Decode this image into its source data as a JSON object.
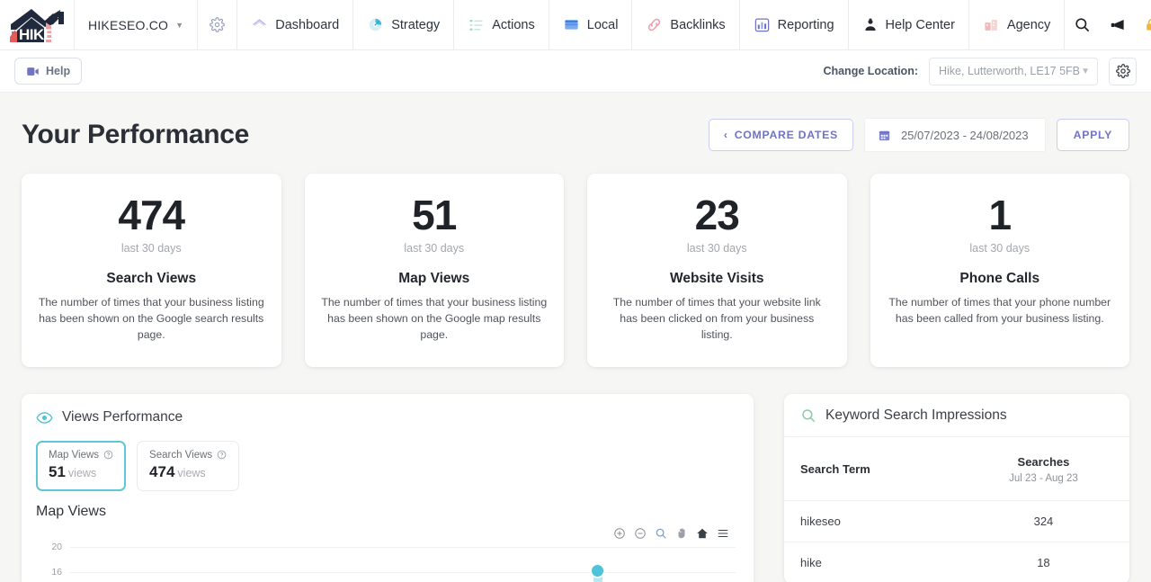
{
  "topnav": {
    "logo_text": "HIKE",
    "brand": "HIKESEO.CO",
    "items": [
      {
        "label": "Dashboard",
        "icon": "home-icon"
      },
      {
        "label": "Strategy",
        "icon": "strategy-icon"
      },
      {
        "label": "Actions",
        "icon": "actions-list-icon"
      },
      {
        "label": "Local",
        "icon": "storefront-icon"
      },
      {
        "label": "Backlinks",
        "icon": "link-icon"
      },
      {
        "label": "Reporting",
        "icon": "bar-chart-icon"
      },
      {
        "label": "Help Center",
        "icon": "support-agent-icon"
      },
      {
        "label": "Agency",
        "icon": "agency-building-icon"
      }
    ],
    "right_icons": [
      "search-icon",
      "megaphone-icon",
      "lock-icon",
      "account-icon"
    ]
  },
  "subbar": {
    "help_label": "Help",
    "change_location_label": "Change Location:",
    "location_value": "Hike, Lutterworth, LE17 5FB",
    "settings_icon": "gear-icon"
  },
  "header": {
    "title": "Your Performance",
    "compare_dates_label": "COMPARE DATES",
    "date_range": "25/07/2023 - 24/08/2023",
    "apply_label": "APPLY"
  },
  "stats": [
    {
      "value": "474",
      "period": "last 30 days",
      "title": "Search Views",
      "description": "The number of times that your business listing has been shown on the Google search results page."
    },
    {
      "value": "51",
      "period": "last 30 days",
      "title": "Map Views",
      "description": "The number of times that your business listing has been shown on the Google map results page."
    },
    {
      "value": "23",
      "period": "last 30 days",
      "title": "Website Visits",
      "description": "The number of times that your website link has been clicked on from your business listing."
    },
    {
      "value": "1",
      "period": "last 30 days",
      "title": "Phone Calls",
      "description": "The number of times that your phone number has been called from your business listing."
    }
  ],
  "views_panel": {
    "title": "Views Performance",
    "icon": "eye-icon",
    "toggles": [
      {
        "label": "Map Views",
        "value": "51",
        "unit": "views",
        "active": true
      },
      {
        "label": "Search Views",
        "value": "474",
        "unit": "views",
        "active": false
      }
    ],
    "chart_name": "Map Views",
    "tools": [
      "zoom-in-icon",
      "zoom-out-icon",
      "selection-zoom-icon",
      "pan-icon",
      "reset-home-icon",
      "menu-icon"
    ]
  },
  "keyword_panel": {
    "title": "Keyword Search Impressions",
    "icon": "search-icon",
    "columns": [
      "Search Term",
      "Searches"
    ],
    "searches_range": "Jul 23 - Aug 23",
    "rows": [
      {
        "term": "hikeseo",
        "searches": "324"
      },
      {
        "term": "hike",
        "searches": "18"
      }
    ]
  },
  "chart_data": {
    "type": "line",
    "title": "Map Views",
    "xlabel": "",
    "ylabel": "",
    "ylim": [
      0,
      20
    ],
    "yticks": [
      20,
      16
    ],
    "grid": true,
    "legend": "none",
    "series": [
      {
        "name": "Map Views",
        "color": "#4ec3da",
        "points": [
          {
            "x": 0.74,
            "y": 15
          }
        ]
      }
    ]
  },
  "colors": {
    "accent_purple": "#6f74c4",
    "accent_teal": "#4ec3da",
    "page_bg": "#f6f6f5",
    "card_bg": "#ffffff"
  }
}
